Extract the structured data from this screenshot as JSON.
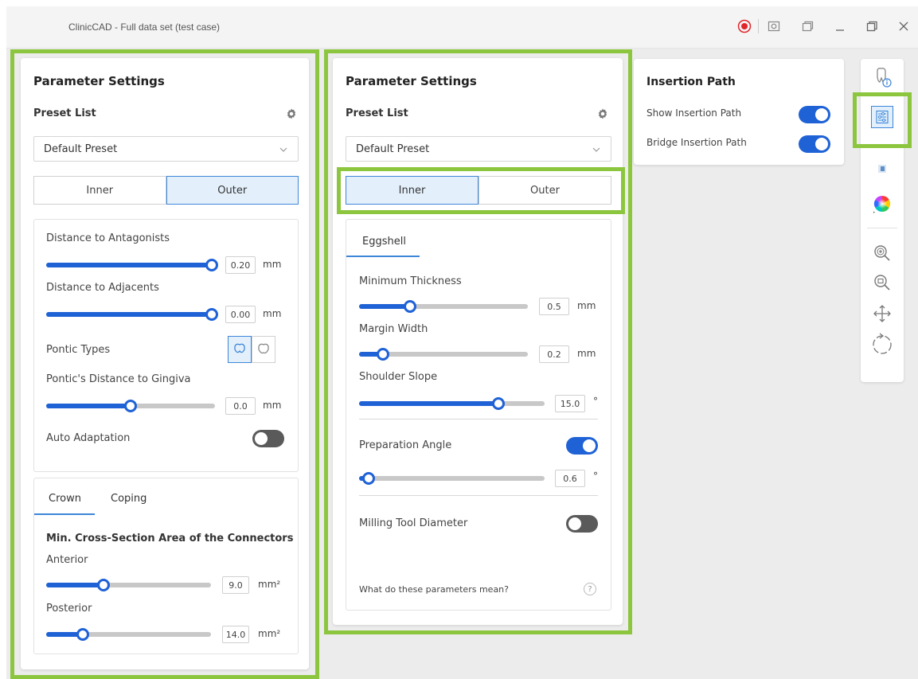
{
  "window": {
    "title": "ClinicCAD - Full data set (test case)"
  },
  "colors": {
    "accent": "#1f62d6",
    "highlight": "#8cc63f",
    "record": "#e0262b"
  },
  "panel_left": {
    "title": "Parameter Settings",
    "preset_label": "Preset List",
    "preset_value": "Default Preset",
    "segments": [
      "Inner",
      "Outer"
    ],
    "active_segment": "Outer",
    "params": [
      {
        "label": "Distance to Antagonists",
        "value": "0.20",
        "unit": "mm",
        "level": 1.0
      },
      {
        "label": "Distance to Adjacents",
        "value": "0.00",
        "unit": "mm",
        "level": 1.0
      },
      {
        "label": "Pontic's Distance to Gingiva",
        "value": "0.0",
        "unit": "mm",
        "level": 0.5
      }
    ],
    "pontic_types_label": "Pontic Types",
    "auto_adaptation_label": "Auto Adaptation",
    "auto_adaptation_on": false,
    "tabs": [
      "Crown",
      "Coping"
    ],
    "active_tab": "Crown",
    "connector_title": "Min. Cross-Section Area of the Connectors",
    "connectors": [
      {
        "label": "Anterior",
        "value": "9.0",
        "unit": "mm²",
        "level": 0.35
      },
      {
        "label": "Posterior",
        "value": "14.0",
        "unit": "mm²",
        "level": 0.22
      }
    ]
  },
  "panel_middle": {
    "title": "Parameter Settings",
    "preset_label": "Preset List",
    "preset_value": "Default Preset",
    "segments": [
      "Inner",
      "Outer"
    ],
    "active_segment": "Inner",
    "tab": "Eggshell",
    "params": [
      {
        "label": "Minimum Thickness",
        "value": "0.5",
        "unit": "mm",
        "level": 0.3
      },
      {
        "label": "Margin Width",
        "value": "0.2",
        "unit": "mm",
        "level": 0.14
      },
      {
        "label": "Shoulder Slope",
        "value": "15.0",
        "unit": "°",
        "level": 0.75
      }
    ],
    "preparation_angle": {
      "label": "Preparation Angle",
      "value": "0.6",
      "unit": "°",
      "level": 0.05,
      "on": true
    },
    "milling_tool_label": "Milling Tool Diameter",
    "milling_tool_on": false,
    "help_text": "What do these parameters mean?",
    "help_icon": "?"
  },
  "insertion_panel": {
    "title": "Insertion Path",
    "items": [
      {
        "label": "Show Insertion Path",
        "on": true
      },
      {
        "label": "Bridge Insertion Path",
        "on": true
      }
    ]
  },
  "toolbar": {
    "icons": [
      "tooth-info-icon",
      "parameter-settings-icon",
      "cube-view-icon",
      "color-wheel-icon",
      "zoom-in-icon",
      "zoom-fit-icon",
      "pan-icon",
      "rotate-icon"
    ],
    "active": "parameter-settings-icon"
  }
}
